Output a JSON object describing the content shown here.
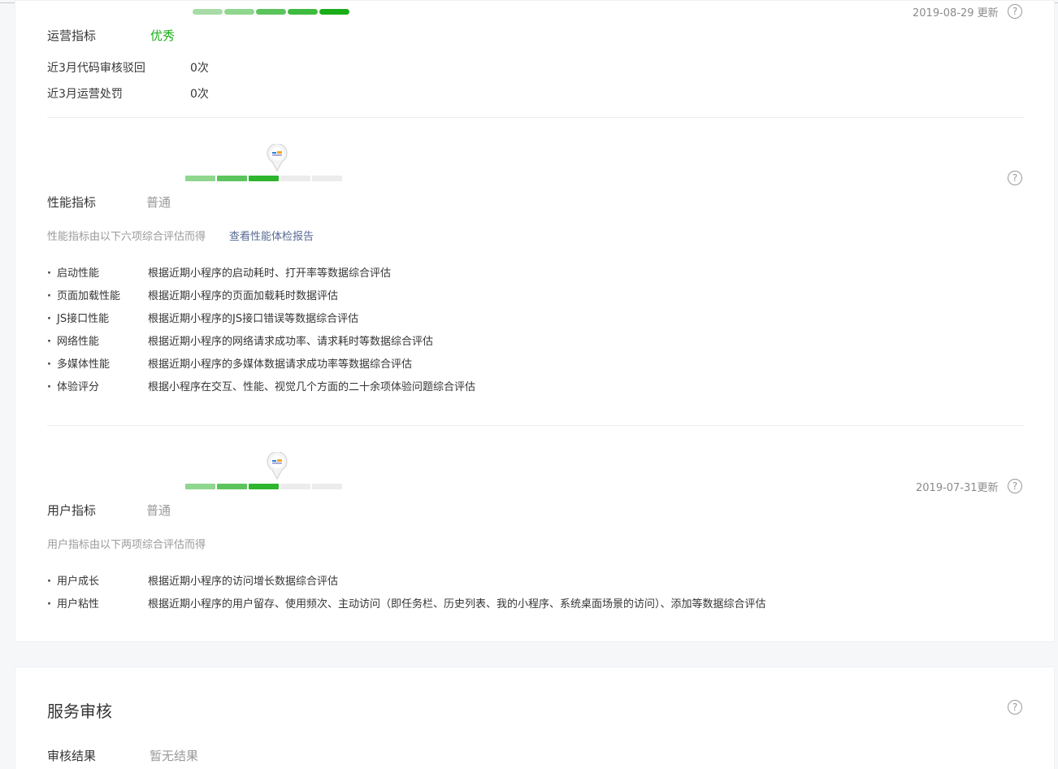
{
  "colors": {
    "good": "#1aad19",
    "seg1": "#8fd68f",
    "seg2": "#5cc45c",
    "seg3": "#2db52d",
    "empty": "#ececec"
  },
  "ops": {
    "updated": "2019-08-29 更新",
    "label": "运营指标",
    "value": "优秀",
    "level_segments": 5,
    "rows": [
      {
        "label": "近3月代码审核驳回",
        "value": "0次"
      },
      {
        "label": "近3月运营处罚",
        "value": "0次"
      }
    ]
  },
  "perf": {
    "label": "性能指标",
    "value": "普通",
    "level_segments": 3,
    "intro": "性能指标由以下六项综合评估而得",
    "report_link": "查看性能体检报告",
    "items": [
      {
        "name": "启动性能",
        "desc": "根据近期小程序的启动耗时、打开率等数据综合评估"
      },
      {
        "name": "页面加载性能",
        "desc": "根据近期小程序的页面加载耗时数据评估"
      },
      {
        "name": "JS接口性能",
        "desc": "根据近期小程序的JS接口错误等数据综合评估"
      },
      {
        "name": "网络性能",
        "desc": "根据近期小程序的网络请求成功率、请求耗时等数据综合评估"
      },
      {
        "name": "多媒体性能",
        "desc": "根据近期小程序的多媒体数据请求成功率等数据综合评估"
      },
      {
        "name": "体验评分",
        "desc": "根据小程序在交互、性能、视觉几个方面的二十余项体验问题综合评估"
      }
    ]
  },
  "user": {
    "updated": "2019-07-31更新",
    "label": "用户指标",
    "value": "普通",
    "level_segments": 3,
    "intro": "用户指标由以下两项综合评估而得",
    "items": [
      {
        "name": "用户成长",
        "desc": "根据近期小程序的访问增长数据综合评估"
      },
      {
        "name": "用户粘性",
        "desc": "根据近期小程序的用户留存、使用频次、主动访问（即任务栏、历史列表、我的小程序、系统桌面场景的访问）、添加等数据综合评估"
      }
    ]
  },
  "service": {
    "title": "服务审核",
    "result_label": "审核结果",
    "result_value": "暂无结果"
  },
  "help_glyph": "?"
}
